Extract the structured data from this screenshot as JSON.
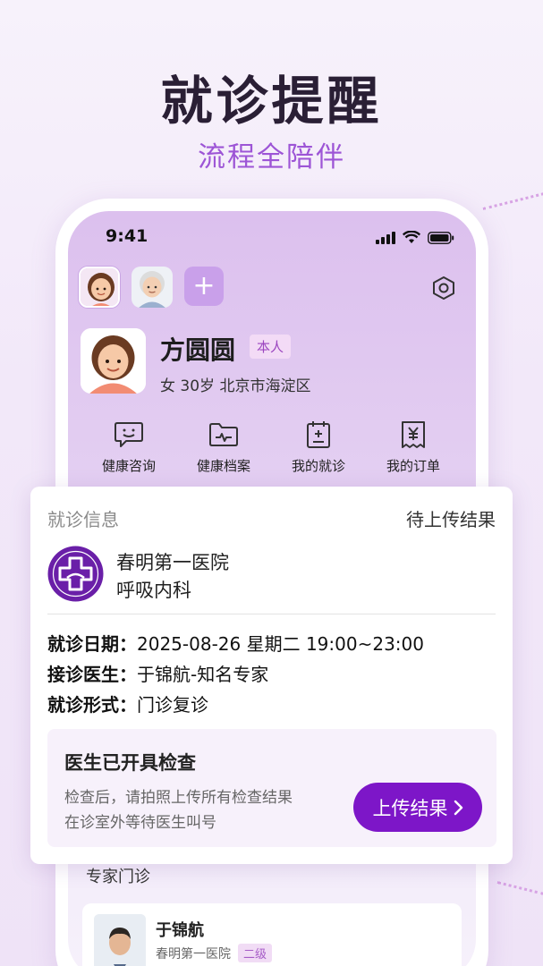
{
  "promo": {
    "headline": "就诊提醒",
    "subline": "流程全陪伴"
  },
  "status_bar": {
    "time": "9:41",
    "icons": [
      "cellular-signal-icon",
      "wifi-icon",
      "battery-icon"
    ]
  },
  "profile_switcher": {
    "avatars": [
      "avatar-woman-icon",
      "avatar-elderly-icon"
    ],
    "add_label": "+",
    "settings_icon": "settings-hexagon-icon"
  },
  "profile": {
    "name": "方圆圆",
    "badge": "本人",
    "info": "女 30岁 北京市海淀区"
  },
  "nav": {
    "items": [
      {
        "label": "健康咨询",
        "icon": "chat-smile-icon"
      },
      {
        "label": "健康档案",
        "icon": "folder-pulse-icon"
      },
      {
        "label": "我的就诊",
        "icon": "clipboard-plus-icon"
      },
      {
        "label": "我的订单",
        "icon": "receipt-yen-icon"
      }
    ]
  },
  "visit": {
    "title": "就诊信息",
    "status": "待上传结果",
    "hospital": "春明第一医院",
    "department": "呼吸内科",
    "date_label": "就诊日期：",
    "date_value": "2025-08-26 星期二 19:00~23:00",
    "doctor_label": "接诊医生：",
    "doctor_value": "于锦航-知名专家",
    "type_label": "就诊形式：",
    "type_value": "门诊复诊",
    "notice": {
      "title": "医生已开具检查",
      "line1": "检查后，请拍照上传所有检查结果",
      "line2": "在诊室外等待医生叫号",
      "button": "上传结果"
    }
  },
  "experts": {
    "section_title": "专家门诊",
    "doctor": {
      "name": "于锦航",
      "hospital": "春明第一医院",
      "level": "二级"
    }
  },
  "colors": {
    "accent": "#7d16c8",
    "subline": "#9d55d6",
    "badge_bg": "#f3dbf6"
  }
}
